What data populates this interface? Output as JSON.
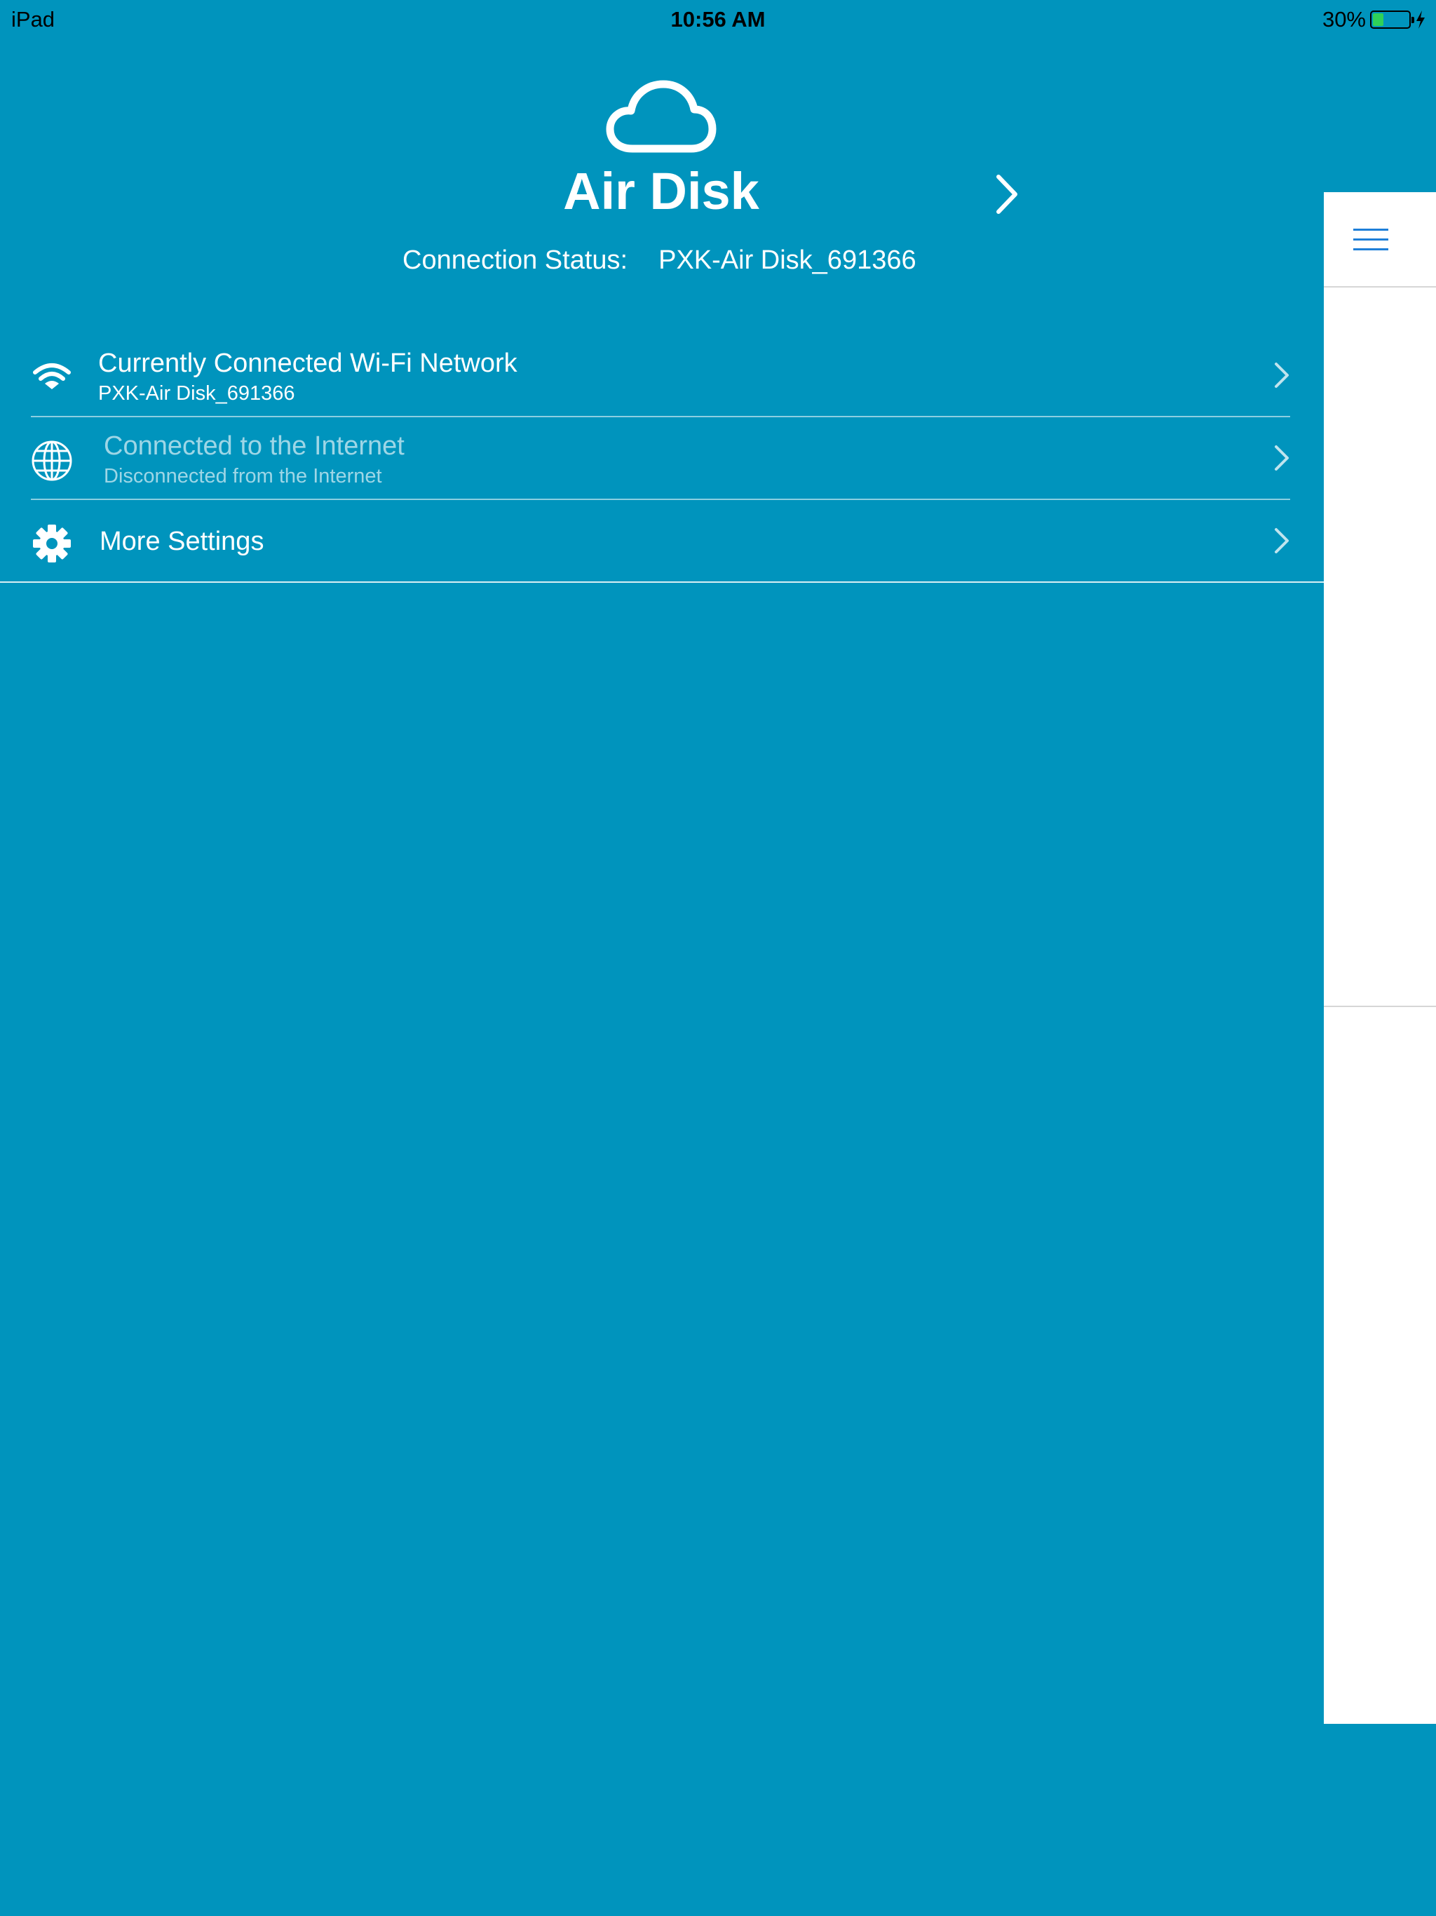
{
  "status_bar": {
    "device": "iPad",
    "time": "10:56 AM",
    "battery_percent": "30%",
    "battery_level": 0.3,
    "charging_icon": "bolt-icon"
  },
  "header": {
    "icon": "cloud-icon",
    "title": "Air Disk",
    "chevron_icon": "chevron-right-icon",
    "connection_label": "Connection Status:",
    "connection_value": "PXK-Air Disk_691366"
  },
  "menu": [
    {
      "icon": "wifi-icon",
      "title": "Currently Connected Wi-Fi Network",
      "subtitle": "PXK-Air Disk_691366",
      "enabled": true
    },
    {
      "icon": "globe-icon",
      "title": "Connected to the Internet",
      "subtitle": "Disconnected from the Internet",
      "enabled": false
    },
    {
      "icon": "gear-icon",
      "title": "More Settings",
      "enabled": true
    }
  ],
  "side_panel": {
    "icon": "hamburger-menu-icon"
  },
  "colors": {
    "background": "#0094bd",
    "panel": "#ffffff",
    "accent": "#1e7fd8",
    "battery": "#2fd158"
  }
}
